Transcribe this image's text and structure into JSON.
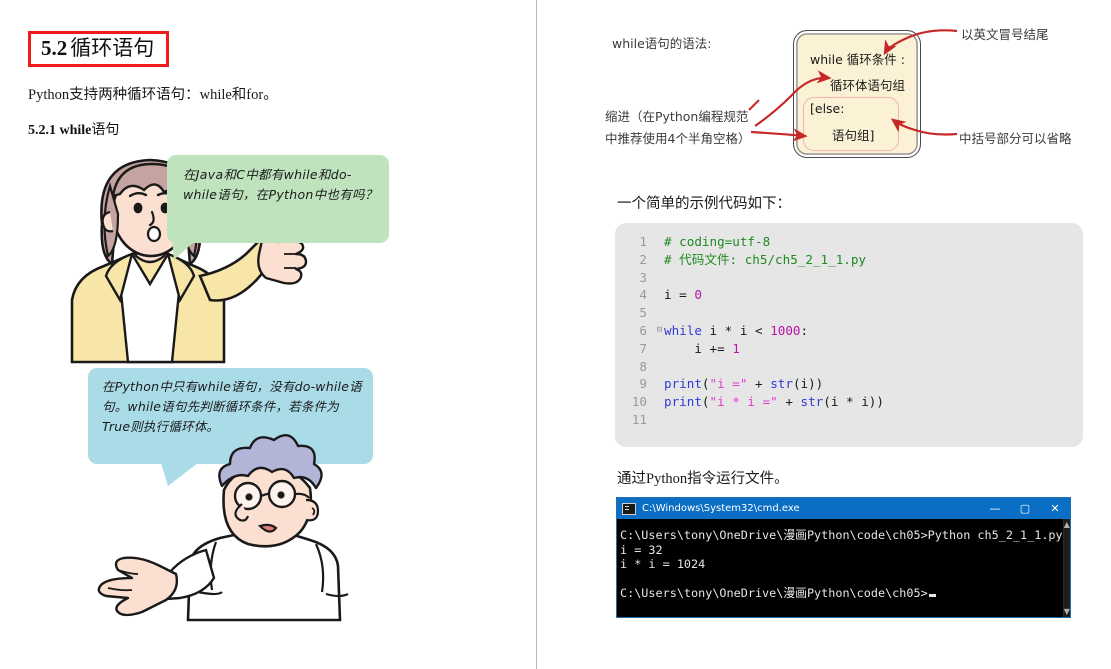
{
  "left": {
    "section": {
      "number": "5.2",
      "title": "循环语句"
    },
    "intro": "Python支持两种循环语句：while和for。",
    "subheading_bold": "5.2.1 while",
    "subheading_rest": "语句",
    "bubble_green": "在Java和C中都有while和do-while语句，在Python中也有吗？",
    "bubble_blue": "在Python中只有while语句，没有do-while语句。while语句先判断循环条件，若条件为True则执行循环体。"
  },
  "right": {
    "syntax_label": "while语句的语法:",
    "annotation_colon": "以英文冒号结尾",
    "annotation_bracket": "中括号部分可以省略",
    "annotation_indent": "缩进（在Python编程规范中推荐使用4个半角空格）",
    "syntax_box": {
      "line1": "while 循环条件 :",
      "line2": "循环体语句组",
      "line3": "[else:",
      "line4": "语句组]"
    },
    "sample_text": "一个简单的示例代码如下：",
    "run_text": "通过Python指令运行文件。",
    "code": {
      "lines": [
        {
          "n": "1",
          "fold": "",
          "tokens": [
            {
              "t": "# coding=utf-8",
              "c": "c-com"
            }
          ]
        },
        {
          "n": "2",
          "fold": "",
          "tokens": [
            {
              "t": "# 代码文件: ch5/ch5_2_1_1.py",
              "c": "c-com"
            }
          ]
        },
        {
          "n": "3",
          "fold": "",
          "tokens": []
        },
        {
          "n": "4",
          "fold": "",
          "tokens": [
            {
              "t": "i ",
              "c": "code"
            },
            {
              "t": "= ",
              "c": "c-op"
            },
            {
              "t": "0",
              "c": "c-num"
            }
          ]
        },
        {
          "n": "5",
          "fold": "",
          "tokens": []
        },
        {
          "n": "6",
          "fold": "-",
          "tokens": [
            {
              "t": "while",
              "c": "c-kw"
            },
            {
              "t": " i ",
              "c": "code"
            },
            {
              "t": "* ",
              "c": "c-op"
            },
            {
              "t": "i ",
              "c": "code"
            },
            {
              "t": "< ",
              "c": "c-op"
            },
            {
              "t": "1000",
              "c": "c-num"
            },
            {
              "t": ":",
              "c": "code"
            }
          ]
        },
        {
          "n": "7",
          "fold": "",
          "tokens": [
            {
              "t": "    i ",
              "c": "code"
            },
            {
              "t": "+= ",
              "c": "c-op"
            },
            {
              "t": "1",
              "c": "c-num"
            }
          ]
        },
        {
          "n": "8",
          "fold": "",
          "tokens": []
        },
        {
          "n": "9",
          "fold": "",
          "tokens": [
            {
              "t": "print",
              "c": "c-fn"
            },
            {
              "t": "(",
              "c": "code"
            },
            {
              "t": "\"i =\"",
              "c": "c-str"
            },
            {
              "t": " + ",
              "c": "c-op"
            },
            {
              "t": "str",
              "c": "c-fn"
            },
            {
              "t": "(i))",
              "c": "code"
            }
          ]
        },
        {
          "n": "10",
          "fold": "",
          "tokens": [
            {
              "t": "print",
              "c": "c-fn"
            },
            {
              "t": "(",
              "c": "code"
            },
            {
              "t": "\"i * i =\"",
              "c": "c-str"
            },
            {
              "t": " + ",
              "c": "c-op"
            },
            {
              "t": "str",
              "c": "c-fn"
            },
            {
              "t": "(i ",
              "c": "code"
            },
            {
              "t": "* ",
              "c": "c-op"
            },
            {
              "t": "i))",
              "c": "code"
            }
          ]
        },
        {
          "n": "11",
          "fold": "",
          "tokens": []
        }
      ]
    },
    "cmd": {
      "title": "C:\\Windows\\System32\\cmd.exe",
      "minimize": "—",
      "maximize": "▢",
      "close": "✕",
      "scroll_up": "▲",
      "scroll_down": "▼",
      "output": "C:\\Users\\tony\\OneDrive\\漫画Python\\code\\ch05>Python ch5_2_1_1.py\ni = 32\ni * i = 1024\n\nC:\\Users\\tony\\OneDrive\\漫画Python\\code\\ch05>"
    }
  },
  "colors": {
    "heading_box": "#ee1c1c",
    "bubble_green": "#bfe3bc",
    "bubble_blue": "#aadce8",
    "syntax_card": "#fbf1d4",
    "arrow_red": "#c62828",
    "code_bg": "#e6e6e6",
    "cmd_titlebar": "#0a6ec4"
  }
}
